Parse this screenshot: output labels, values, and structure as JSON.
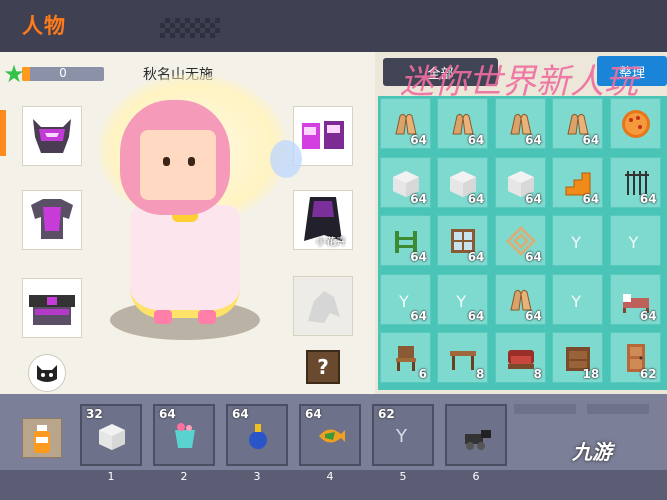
{
  "header": {
    "title": "人物"
  },
  "player": {
    "name": "秋名山无施",
    "star_value": "0",
    "exp_fraction": 0.1
  },
  "character_label": "小花卉",
  "help_button_label": "?",
  "inventory": {
    "tab_all_label": "全部",
    "sort_label": "整理",
    "watermark": "迷你世界新人玩",
    "cells": [
      {
        "icon": "wing-icon",
        "count": "64"
      },
      {
        "icon": "wing-icon",
        "count": "64"
      },
      {
        "icon": "wing-icon",
        "count": "64"
      },
      {
        "icon": "wing-icon",
        "count": "64"
      },
      {
        "icon": "pizza-icon",
        "count": ""
      },
      {
        "icon": "white-block-icon",
        "count": "64"
      },
      {
        "icon": "white-block-icon",
        "count": "64"
      },
      {
        "icon": "white-block-icon",
        "count": "64"
      },
      {
        "icon": "orange-stairs-icon",
        "count": "64"
      },
      {
        "icon": "iron-bars-icon",
        "count": "64"
      },
      {
        "icon": "fence-icon",
        "count": "64"
      },
      {
        "icon": "window-icon",
        "count": "64"
      },
      {
        "icon": "lattice-icon",
        "count": "64"
      },
      {
        "icon": "",
        "count": ""
      },
      {
        "icon": "",
        "count": ""
      },
      {
        "icon": "",
        "count": "64"
      },
      {
        "icon": "",
        "count": "64"
      },
      {
        "icon": "wing-icon",
        "count": "64"
      },
      {
        "icon": "",
        "count": ""
      },
      {
        "icon": "bed-icon",
        "count": "64"
      },
      {
        "icon": "chair-icon",
        "count": "6"
      },
      {
        "icon": "table-icon",
        "count": "8"
      },
      {
        "icon": "sofa-icon",
        "count": "8"
      },
      {
        "icon": "cabinet-icon",
        "count": "18"
      },
      {
        "icon": "door-icon",
        "count": "62"
      }
    ]
  },
  "hotbar": [
    {
      "num": "1",
      "count": "32",
      "icon": "white-block-icon"
    },
    {
      "num": "2",
      "count": "64",
      "icon": "drink-icon"
    },
    {
      "num": "3",
      "count": "64",
      "icon": "potion-icon"
    },
    {
      "num": "4",
      "count": "64",
      "icon": "fish-icon"
    },
    {
      "num": "5",
      "count": "62",
      "icon": ""
    },
    {
      "num": "6",
      "count": "",
      "icon": "cannon-icon"
    }
  ],
  "logo_text": "九游",
  "colors": {
    "header_title": "#ff7a18",
    "grid_bg": "#49c4b7",
    "sort_button": "#1a84d8"
  }
}
